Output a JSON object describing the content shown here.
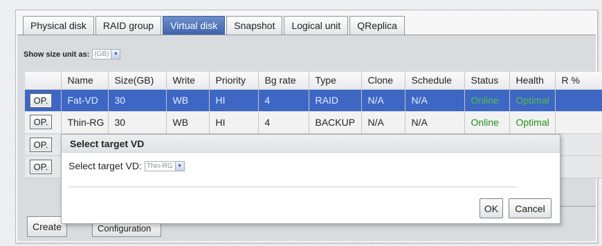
{
  "tabs": [
    {
      "label": "Physical disk"
    },
    {
      "label": "RAID group"
    },
    {
      "label": "Virtual disk",
      "active": true
    },
    {
      "label": "Snapshot"
    },
    {
      "label": "Logical unit"
    },
    {
      "label": "QReplica"
    }
  ],
  "size_unit": {
    "label": "Show size unit as:",
    "value": "(GB)"
  },
  "table": {
    "headers": [
      "",
      "Name",
      "Size(GB)",
      "Write",
      "Priority",
      "Bg rate",
      "Type",
      "Clone",
      "Schedule",
      "Status",
      "Health",
      "R %"
    ],
    "rows": [
      {
        "op": "OP.",
        "name": "Fat-VD",
        "size": "30",
        "write": "WB",
        "priority": "HI",
        "bg_rate": "4",
        "type": "RAID",
        "clone": "N/A",
        "schedule": "N/A",
        "status": "Online",
        "health": "Optimal",
        "r_pct": ""
      },
      {
        "op": "OP.",
        "name": "Thin-RG",
        "size": "30",
        "write": "WB",
        "priority": "HI",
        "bg_rate": "4",
        "type": "BACKUP",
        "clone": "N/A",
        "schedule": "N/A",
        "status": "Online",
        "health": "Optimal",
        "r_pct": ""
      },
      {
        "op": "OP."
      },
      {
        "op": "OP."
      }
    ]
  },
  "buttons": {
    "create": "Create",
    "configuration": "Configuration"
  },
  "dialog": {
    "title": "Select target VD",
    "field_label": "Select target VD:",
    "field_value": "Thin-RG",
    "ok": "OK",
    "cancel": "Cancel"
  },
  "colors": {
    "tab_active": "#3f63ad",
    "row_selected": "#3e67c4",
    "status_green": "#1f8f1f"
  }
}
